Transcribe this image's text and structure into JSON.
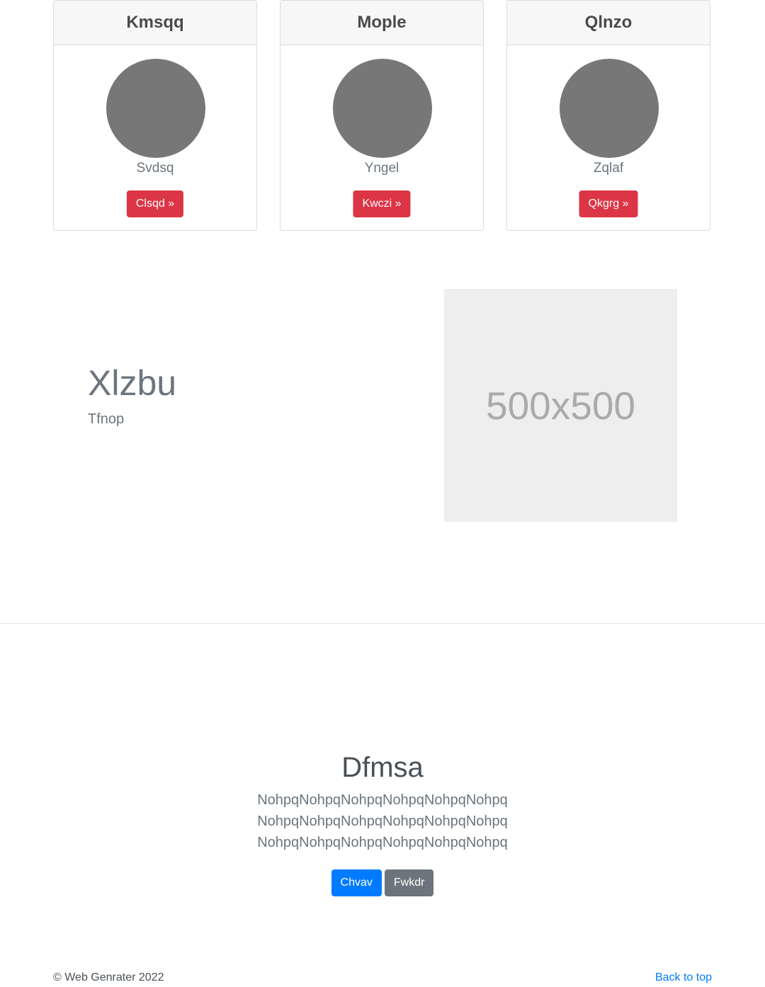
{
  "cards": [
    {
      "title": "Kmsqq",
      "subtitle": "Svdsq",
      "button": "Clsqd »"
    },
    {
      "title": "Mople",
      "subtitle": "Yngel",
      "button": "Kwczi »"
    },
    {
      "title": "Qlnzo",
      "subtitle": "Zqlaf",
      "button": "Qkgrg »"
    }
  ],
  "feature": {
    "title": "Xlzbu",
    "subtitle": "Tfnop",
    "image_label": "500x500"
  },
  "hero": {
    "title": "Dfmsa",
    "lines": [
      "NohpqNohpqNohpqNohpqNohpqNohpq",
      "NohpqNohpqNohpqNohpqNohpqNohpq",
      "NohpqNohpqNohpqNohpqNohpqNohpq"
    ],
    "primary_button": "Chvav",
    "secondary_button": "Fwkdr"
  },
  "footer": {
    "copyright": "© Web Genrater 2022",
    "back_to_top": "Back to top"
  },
  "colors": {
    "danger": "#dc3545",
    "primary": "#007bff",
    "secondary": "#6c757d",
    "avatar": "#777777",
    "placeholder_bg": "#eeeeee"
  }
}
